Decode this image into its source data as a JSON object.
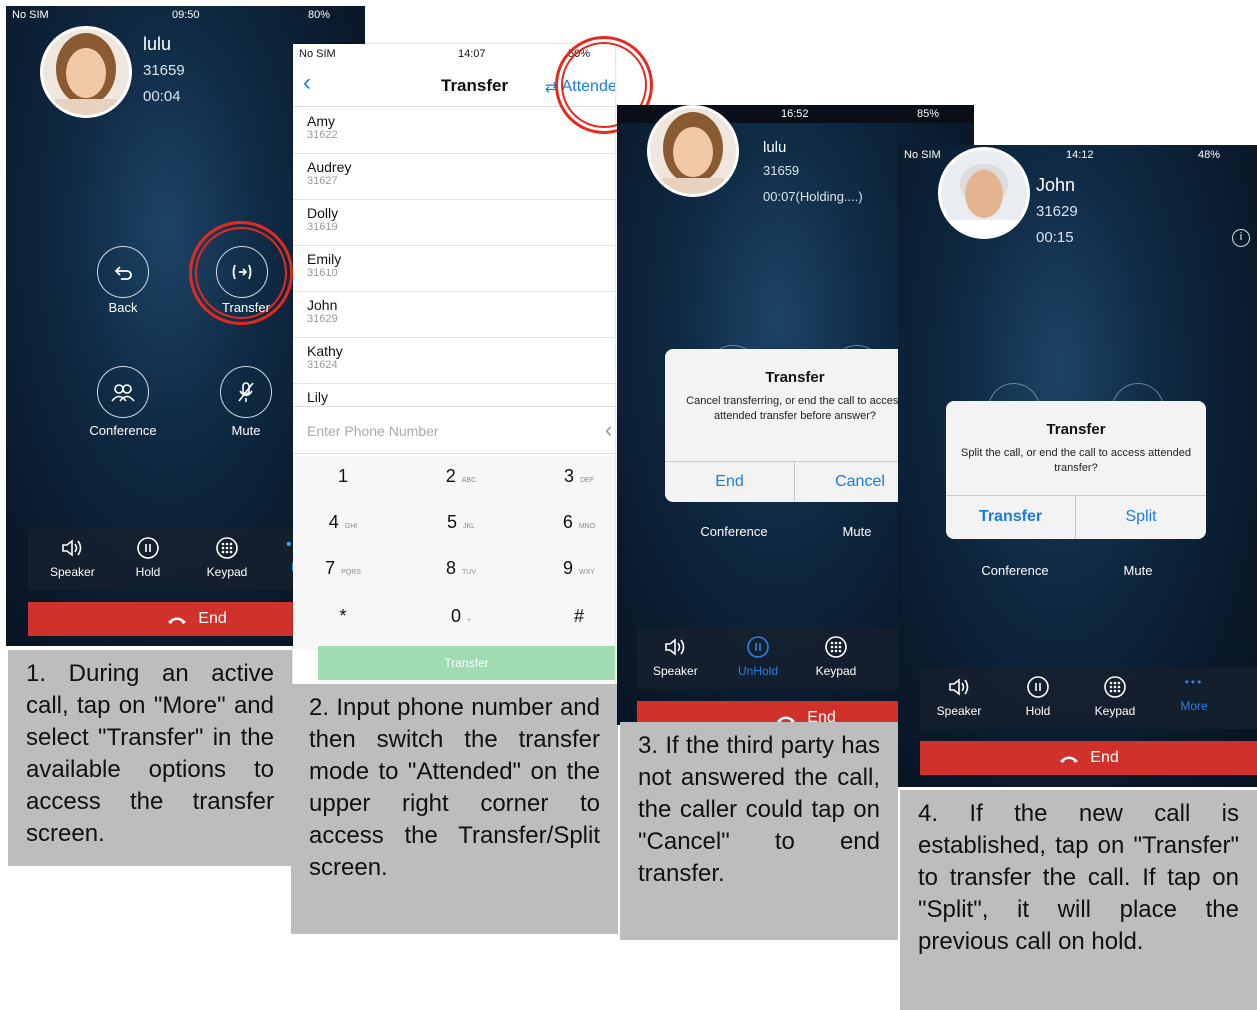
{
  "panel1": {
    "status": {
      "carrier": "No SIM",
      "time": "09:50",
      "battery": "80%"
    },
    "caller": {
      "name": "lulu",
      "number": "31659",
      "duration": "00:04"
    },
    "buttons": [
      {
        "label": "Back",
        "icon": "back-arrow-icon"
      },
      {
        "label": "Transfer",
        "icon": "transfer-icon"
      },
      {
        "label": "Conference",
        "icon": "conference-icon"
      },
      {
        "label": "Mute",
        "icon": "mute-mic-icon"
      }
    ],
    "toolbar": [
      {
        "label": "Speaker",
        "icon": "speaker-icon"
      },
      {
        "label": "Hold",
        "icon": "pause-icon"
      },
      {
        "label": "Keypad",
        "icon": "keypad-icon"
      },
      {
        "label": "M",
        "icon": "more-icon"
      }
    ],
    "end_label": "End",
    "caption": "1. During an active call, tap on \"More\" and select \"Transfer\" in the available options to access the transfer screen."
  },
  "panel2": {
    "status": {
      "carrier": "No SIM",
      "time": "14:07",
      "battery": "50%"
    },
    "title": "Transfer",
    "mode_label": "Attended",
    "contacts": [
      {
        "name": "Amy",
        "number": "31622"
      },
      {
        "name": "Audrey",
        "number": "31627"
      },
      {
        "name": "Dolly",
        "number": "31619"
      },
      {
        "name": "Emily",
        "number": "31610"
      },
      {
        "name": "John",
        "number": "31629"
      },
      {
        "name": "Kathy",
        "number": "31624"
      },
      {
        "name": "Lily",
        "number": ""
      }
    ],
    "input_placeholder": "Enter Phone Number",
    "keys": [
      {
        "digit": "1",
        "letters": ""
      },
      {
        "digit": "2",
        "letters": "ABC"
      },
      {
        "digit": "3",
        "letters": "DEF"
      },
      {
        "digit": "4",
        "letters": "GHI"
      },
      {
        "digit": "5",
        "letters": "JKL"
      },
      {
        "digit": "6",
        "letters": "MNO"
      },
      {
        "digit": "7",
        "letters": "PQRS"
      },
      {
        "digit": "8",
        "letters": "TUV"
      },
      {
        "digit": "9",
        "letters": "WXY"
      },
      {
        "digit": "*",
        "letters": ""
      },
      {
        "digit": "0",
        "letters": "+"
      },
      {
        "digit": "#",
        "letters": ""
      }
    ],
    "transfer_button": "Transfer",
    "caption": "2. Input phone number and then switch the transfer mode to \"Attended\" on the upper right corner to access the Transfer/Split screen."
  },
  "panel3": {
    "status": {
      "time": "16:52",
      "battery": "85%"
    },
    "caller": {
      "name": "lulu",
      "number": "31659",
      "duration": "00:07(Holding....)"
    },
    "dialog": {
      "title": "Transfer",
      "message": "Cancel transferring, or end the call to access attended transfer before answer?",
      "left": "End",
      "right": "Cancel"
    },
    "labels": {
      "conference": "Conference",
      "mute": "Mute"
    },
    "toolbar": [
      {
        "label": "Speaker",
        "icon": "speaker-icon"
      },
      {
        "label": "UnHold",
        "icon": "pause-icon"
      },
      {
        "label": "Keypad",
        "icon": "keypad-icon"
      }
    ],
    "end_label": "End",
    "caption": "3. If the third party has not answered the call, the caller could tap on \"Cancel\" to end transfer."
  },
  "panel4": {
    "status": {
      "carrier": "No SIM",
      "time": "14:12",
      "battery": "48%"
    },
    "caller": {
      "name": "John",
      "number": "31629",
      "duration": "00:15"
    },
    "dialog": {
      "title": "Transfer",
      "message": "Split the call, or end the call to access attended transfer?",
      "left": "Transfer",
      "right": "Split"
    },
    "labels": {
      "conference": "Conference",
      "mute": "Mute"
    },
    "toolbar": [
      {
        "label": "Speaker",
        "icon": "speaker-icon"
      },
      {
        "label": "Hold",
        "icon": "pause-icon"
      },
      {
        "label": "Keypad",
        "icon": "keypad-icon"
      },
      {
        "label": "More",
        "icon": "more-icon"
      }
    ],
    "end_label": "End",
    "caption": "4. If the new call is established, tap on \"Transfer\" to transfer the call. If tap on \"Split\", it will place the previous call on hold."
  }
}
